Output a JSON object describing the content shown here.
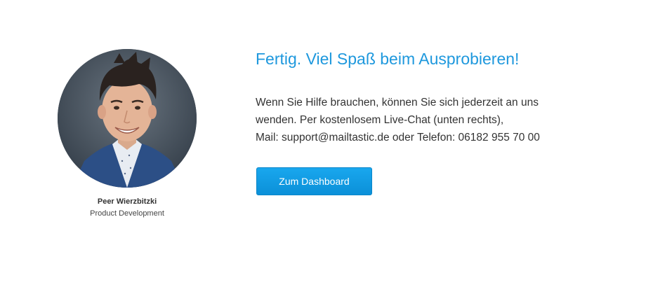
{
  "profile": {
    "name": "Peer Wierzbitzki",
    "role": "Product Development",
    "photo": "portrait-photo"
  },
  "content": {
    "headline": "Fertig. Viel Spaß beim Ausprobieren!",
    "message_lines": [
      "Wenn Sie Hilfe brauchen, können Sie sich jederzeit an uns",
      "wenden. Per kostenlosem Live-Chat (unten rechts),",
      "Mail: support@mailtastic.de oder Telefon: 06182 955 70 00"
    ],
    "button_label": "Zum Dashboard"
  },
  "colors": {
    "accent": "#1e98dd",
    "button": "#0b90d8",
    "text": "#333333",
    "background": "#ffffff"
  }
}
